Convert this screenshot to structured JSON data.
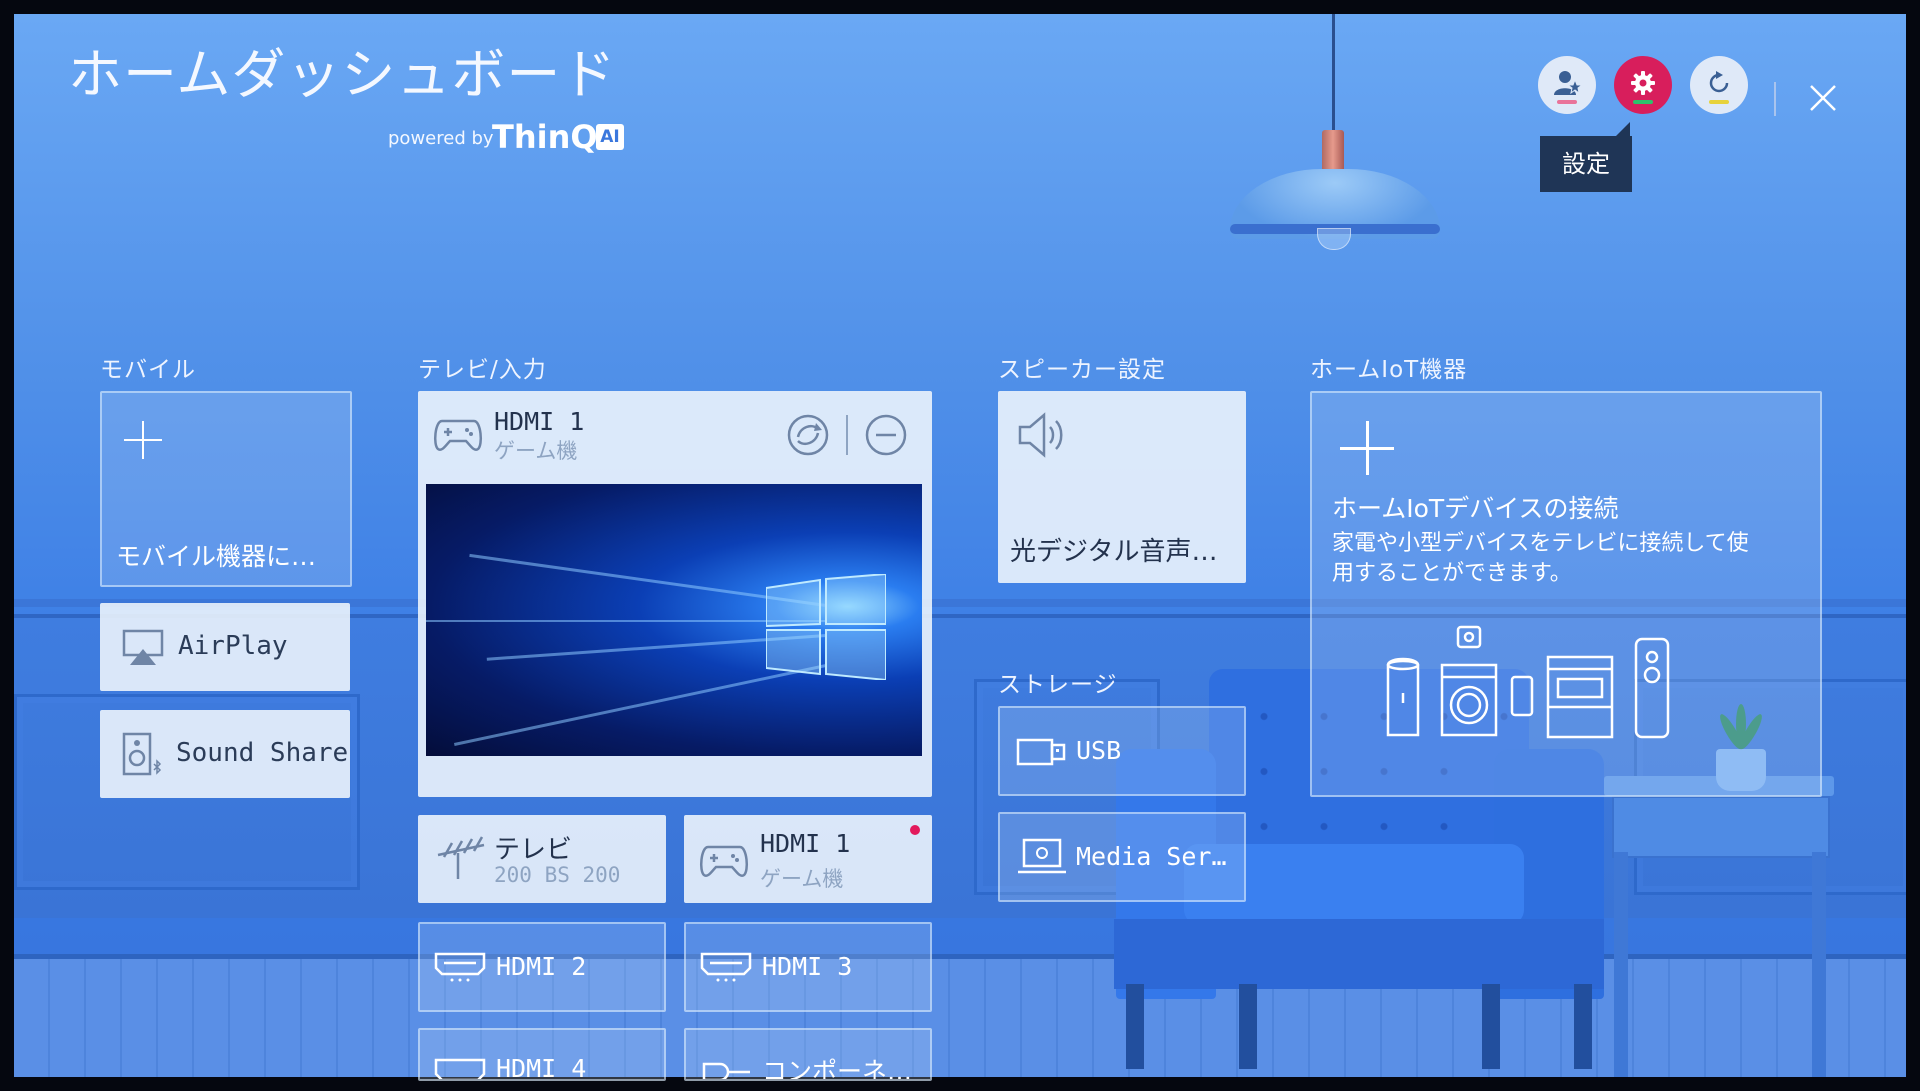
{
  "header": {
    "title": "ホームダッシュボード",
    "powered_by": "powered by",
    "brand": "ThinQ",
    "brand_badge": "AI"
  },
  "top_actions": {
    "buttons": [
      {
        "name": "account",
        "icon": "user-star-icon",
        "indicator_color": "#e9739a"
      },
      {
        "name": "settings",
        "icon": "gear-icon",
        "indicator_color": "#2cc26b",
        "active": true
      },
      {
        "name": "refresh",
        "icon": "refresh-icon",
        "indicator_color": "#e7d23c"
      }
    ],
    "tooltip": "設定",
    "close_icon": "close-icon"
  },
  "sections": {
    "mobile": "モバイル",
    "tv_input": "テレビ/入力",
    "speaker": "スピーカー設定",
    "storage": "ストレージ",
    "home_iot": "ホームIoT機器"
  },
  "mobile": {
    "add_card_label": "モバイル機器に…",
    "airplay": "AirPlay",
    "sound_share": "Sound Share"
  },
  "tv_input": {
    "current": {
      "name": "HDMI 1",
      "device": "ゲーム機"
    },
    "inputs": [
      {
        "name": "テレビ",
        "sub": "200 BS 200",
        "icon": "antenna-icon"
      },
      {
        "name": "HDMI 1",
        "sub": "ゲーム機",
        "icon": "gamepad-icon",
        "active": true
      },
      {
        "name": "HDMI 2",
        "icon": "hdmi-icon"
      },
      {
        "name": "HDMI 3",
        "icon": "hdmi-icon"
      },
      {
        "name": "HDMI 4",
        "icon": "hdmi-icon"
      },
      {
        "name": "コンポーネ…",
        "icon": "component-icon"
      }
    ]
  },
  "speaker": {
    "label": "光デジタル音声…"
  },
  "storage": {
    "items": [
      {
        "name": "USB",
        "icon": "usb-icon"
      },
      {
        "name": "Media Ser…",
        "icon": "media-server-icon"
      }
    ]
  },
  "home_iot": {
    "title": "ホームIoTデバイスの接続",
    "description_line1": "家電や小型デバイスをテレビに接続して使",
    "description_line2": "用することができます。"
  },
  "colors": {
    "accent": "#d81e5c",
    "background": "#4f8fe8",
    "card": "#ebf3fc"
  }
}
